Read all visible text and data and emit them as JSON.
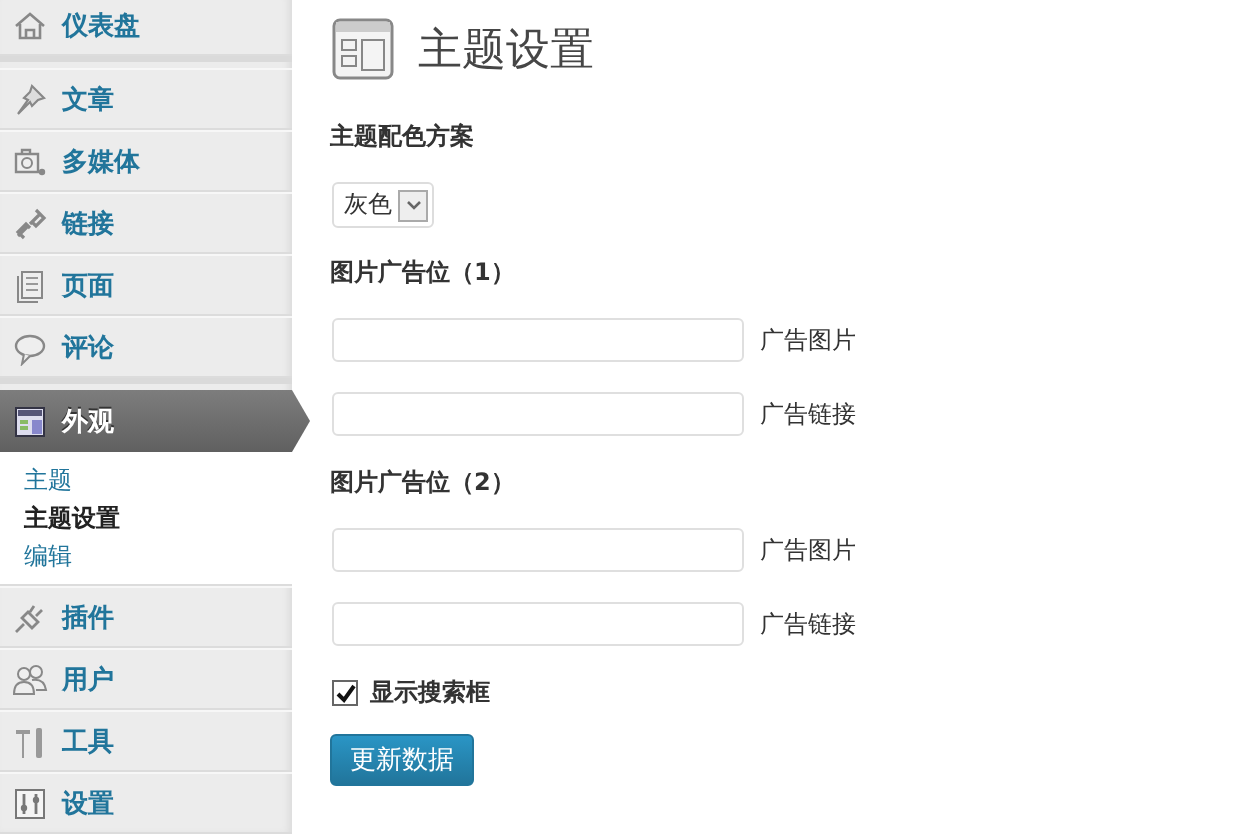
{
  "sidebar": {
    "groups": [
      [
        {
          "label": "仪表盘",
          "selected": false
        }
      ],
      [
        {
          "label": "文章",
          "selected": false
        },
        {
          "label": "多媒体",
          "selected": false
        },
        {
          "label": "链接",
          "selected": false
        },
        {
          "label": "页面",
          "selected": false
        },
        {
          "label": "评论",
          "selected": false
        }
      ],
      [
        {
          "label": "外观",
          "selected": true,
          "submenu": [
            {
              "label": "主题",
              "selected": false
            },
            {
              "label": "主题设置",
              "selected": true
            },
            {
              "label": "编辑",
              "selected": false
            }
          ]
        },
        {
          "label": "插件",
          "selected": false
        },
        {
          "label": "用户",
          "selected": false
        },
        {
          "label": "工具",
          "selected": false
        },
        {
          "label": "设置",
          "selected": false
        }
      ]
    ]
  },
  "page_title": "主题设置",
  "fields": [
    {
      "kind": "heading",
      "label": "主题配色方案"
    },
    {
      "kind": "select",
      "value": "灰色"
    },
    {
      "kind": "heading",
      "label": "图片广告位（1）"
    },
    {
      "kind": "text",
      "label": "广告图片"
    },
    {
      "kind": "text",
      "label": "广告链接"
    },
    {
      "kind": "heading",
      "label": "图片广告位（2）"
    },
    {
      "kind": "text",
      "label": "广告图片"
    },
    {
      "kind": "text",
      "label": "广告链接"
    },
    {
      "kind": "checkbox",
      "label": "显示搜索框",
      "checked": true
    }
  ],
  "submit": "更新数据"
}
